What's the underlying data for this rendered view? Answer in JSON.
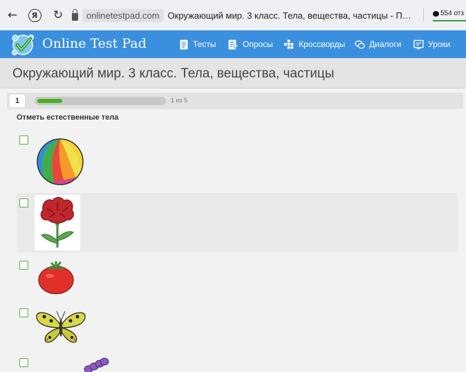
{
  "browser": {
    "domain": "onlinetestpad.com",
    "tab_title": "Окружающий мир. 3 класс. Тела, вещества, частицы - Пройт...",
    "reviews": "554 отз"
  },
  "site": {
    "brand": "Online Test Pad",
    "nav": {
      "tests": "Тесты",
      "polls": "Опросы",
      "crosswords": "Кроссворды",
      "dialogs": "Диалоги",
      "lessons": "Уроки"
    }
  },
  "test": {
    "title": "Окружающий мир. 3 класс. Тела, вещества, частицы",
    "question_number": "1",
    "progress_label": "1 из 5",
    "progress_fraction": 0.2,
    "question": "Отметь естественные тела"
  },
  "options": [
    {
      "image": "beach-ball",
      "checked": false
    },
    {
      "image": "carnation-flower",
      "checked": false
    },
    {
      "image": "tomato",
      "checked": false
    },
    {
      "image": "butterfly",
      "checked": false
    },
    {
      "image": "caterpillar",
      "checked": false
    }
  ],
  "colors": {
    "header_blue": "#3a8fde",
    "progress_green": "#4caf22",
    "checkbox_green": "#56b13c"
  }
}
